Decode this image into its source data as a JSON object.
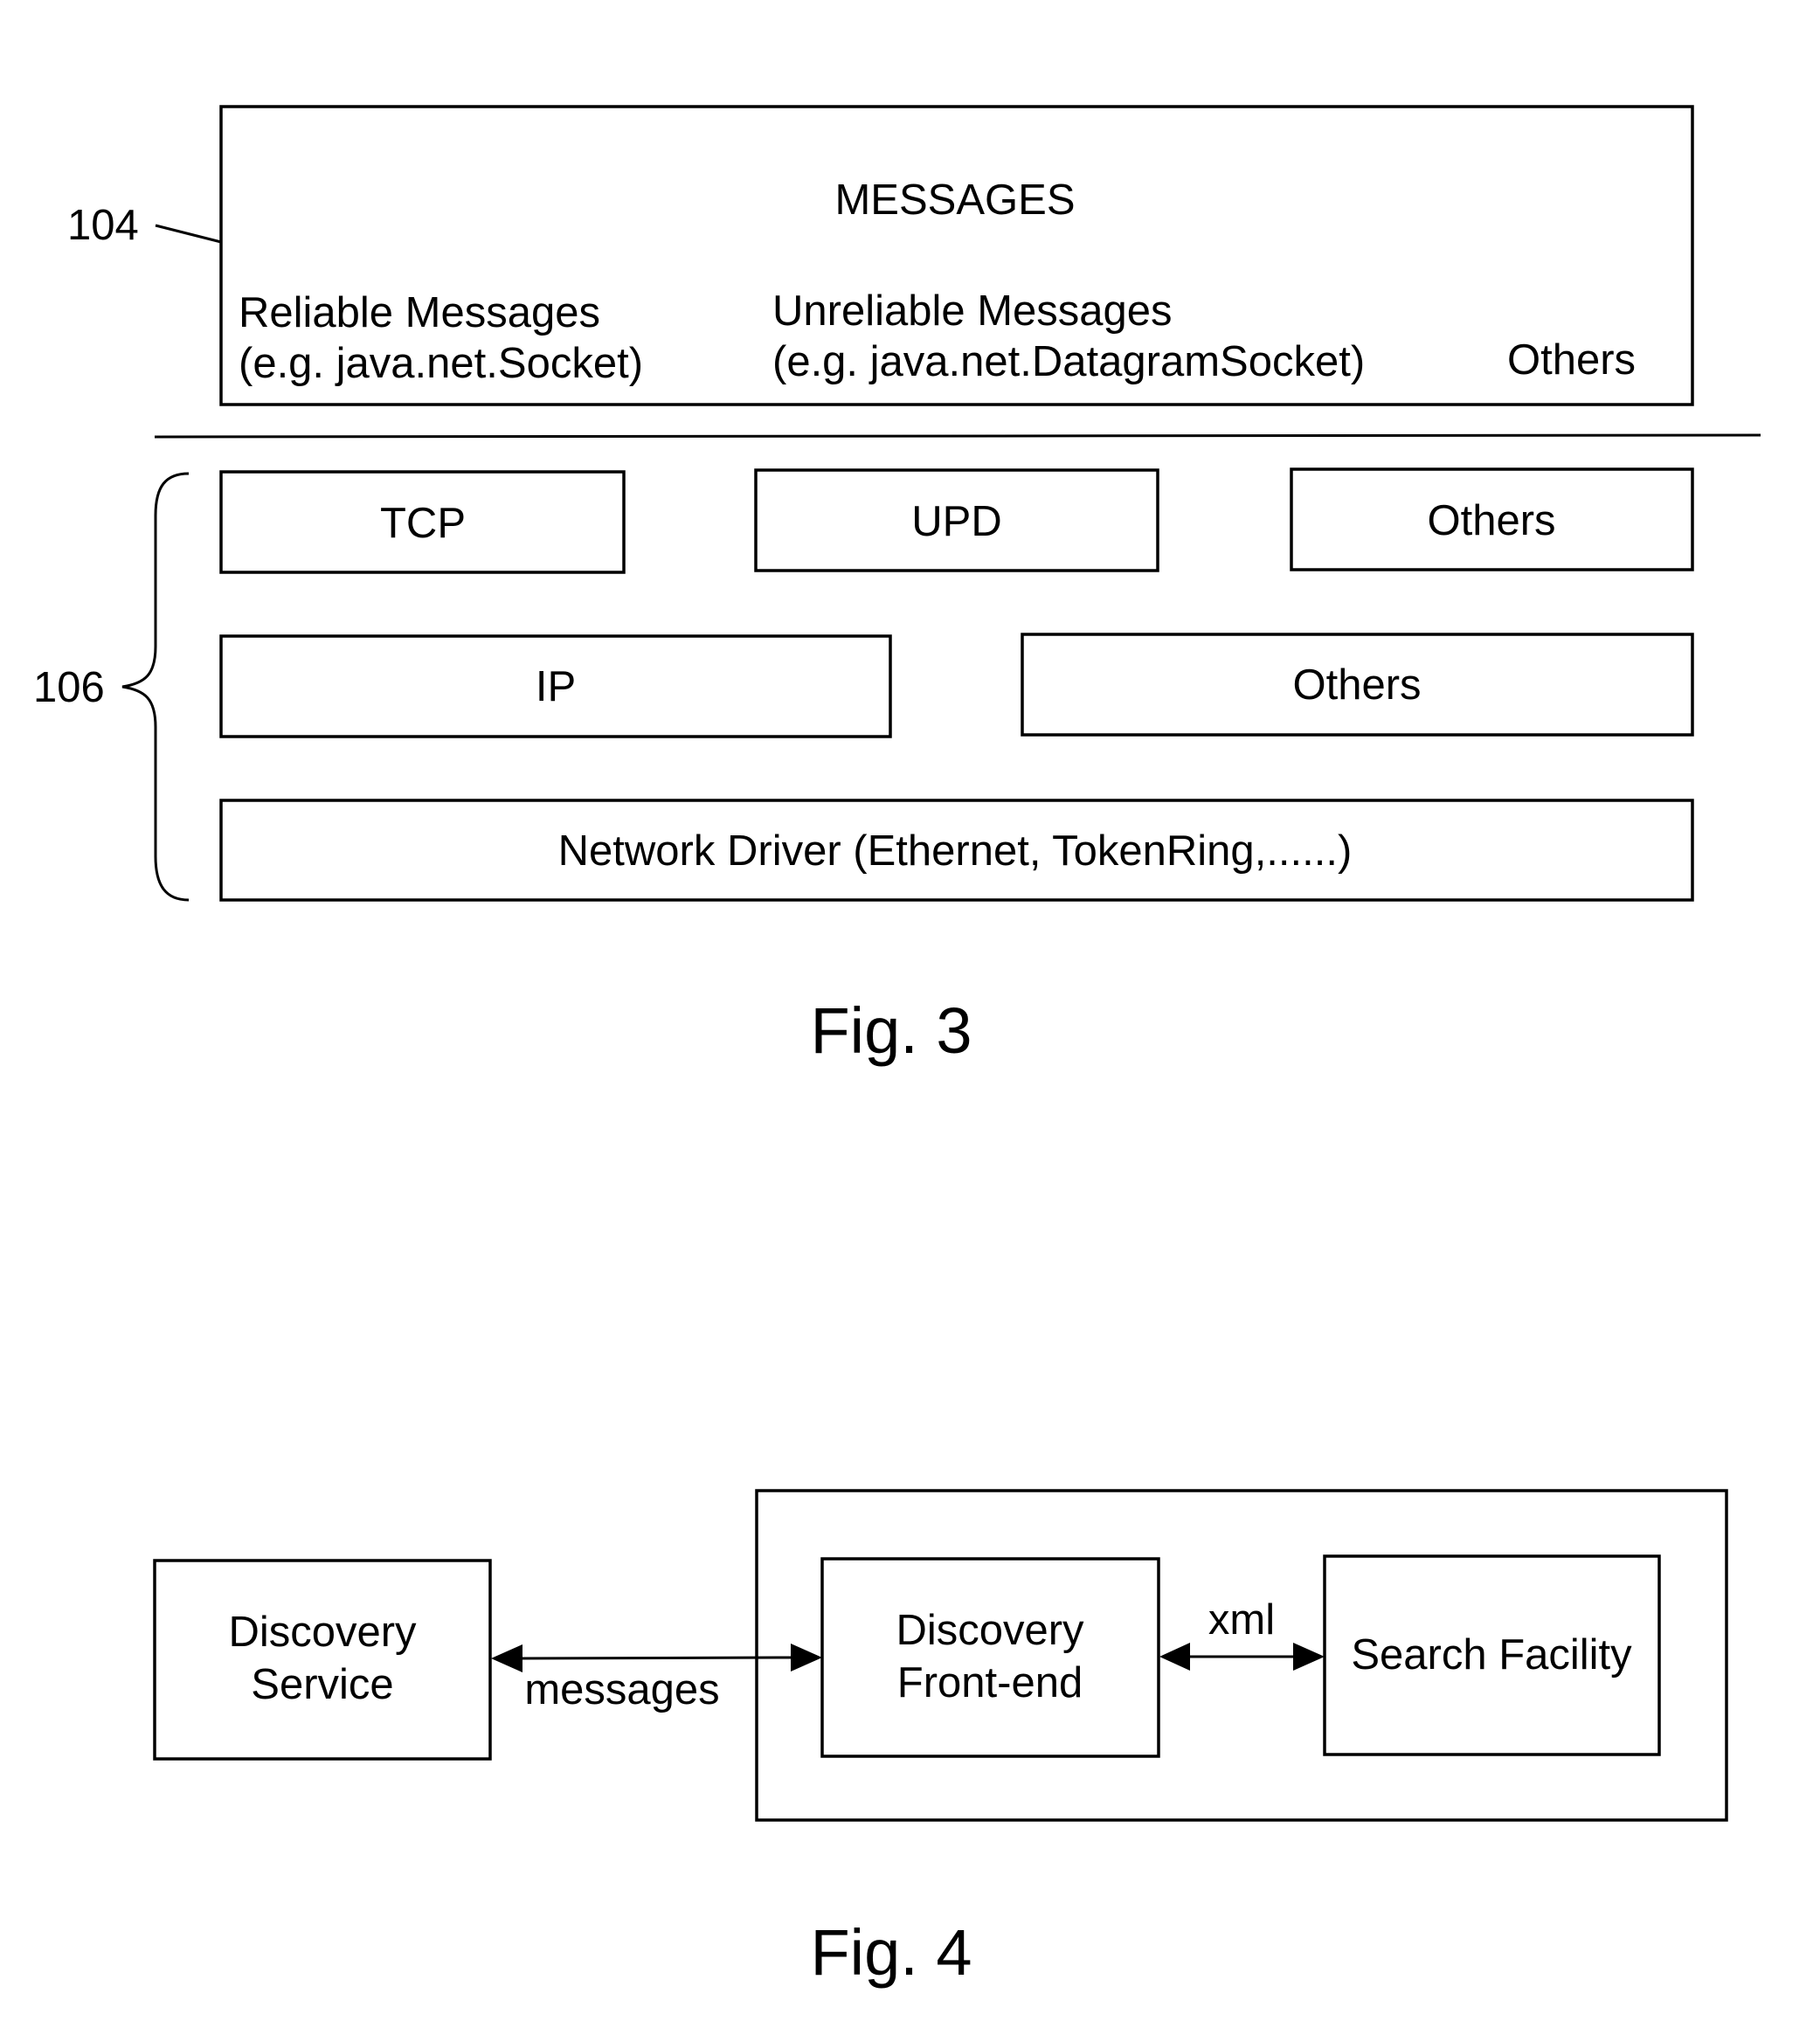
{
  "fig3": {
    "caption": "Fig. 3",
    "ref_messages_layer": "104",
    "ref_transport_stack": "106",
    "messages_box": {
      "title": "MESSAGES",
      "reliable": {
        "line1": "Reliable Messages",
        "line2": "(e.g. java.net.Socket)"
      },
      "unreliable": {
        "line1": "Unreliable Messages",
        "line2": "(e.g. java.net.DatagramSocket)"
      },
      "others": "Others"
    },
    "transport_row": [
      "TCP",
      "UPD",
      "Others"
    ],
    "network_row": [
      "IP",
      "Others"
    ],
    "driver": "Network Driver (Ethernet, TokenRing,......)"
  },
  "fig4": {
    "caption": "Fig. 4",
    "discovery_service": {
      "line1": "Discovery",
      "line2": "Service"
    },
    "discovery_frontend": {
      "line1": "Discovery",
      "line2": "Front-end"
    },
    "search_facility": "Search Facility",
    "link_messages": "messages",
    "link_xml": "xml"
  }
}
